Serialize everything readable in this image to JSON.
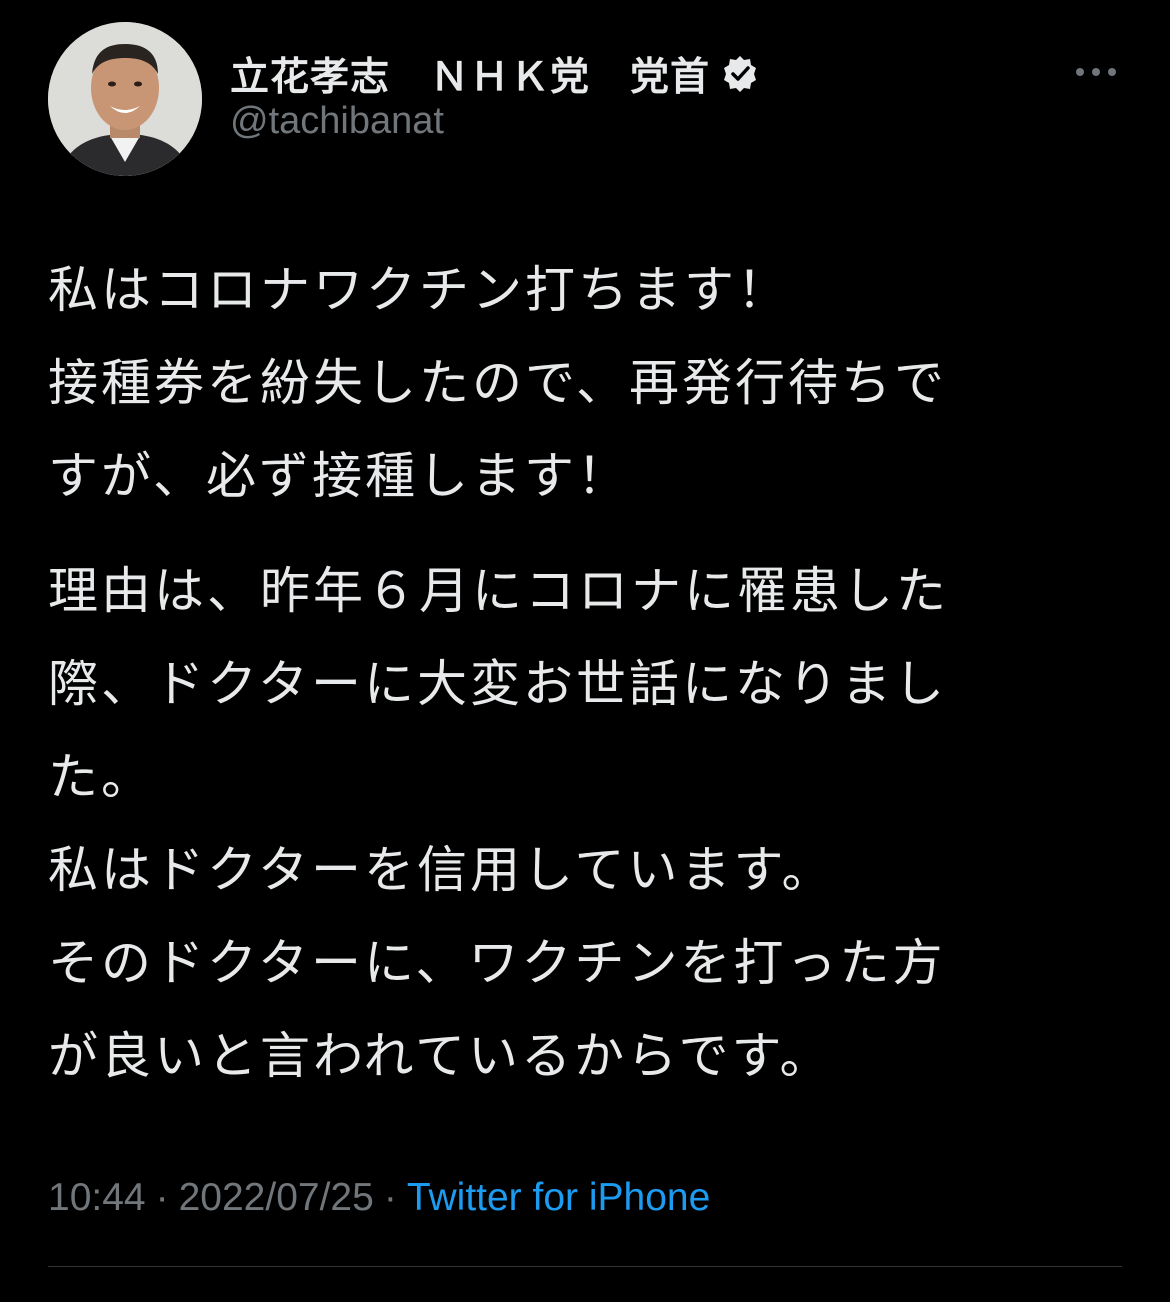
{
  "author": {
    "display_name": "立花孝志　ＮＨＫ党　党首",
    "handle": "@tachibanat",
    "verified": true
  },
  "icons": {
    "avatar": "avatar",
    "verified": "verified-badge-icon",
    "more": "more-options-icon"
  },
  "tweet": {
    "paragraphs": [
      "私はコロナワクチン打ちます！\n接種券を紛失したので、再発行待ちで\nすが、必ず接種します！",
      "理由は、昨年６月にコロナに罹患した\n際、ドクターに大変お世話になりまし\nた。\n私はドクターを信用しています。\nそのドクターに、ワクチンを打った方\nが良いと言われているからです。"
    ]
  },
  "meta": {
    "time": "10:44",
    "separator": "·",
    "date": "2022/07/25",
    "source": "Twitter for iPhone"
  },
  "colors": {
    "background": "#000000",
    "text": "#e7e9ea",
    "secondary": "#71767b",
    "link": "#1d9bf0",
    "divider": "#2f3336"
  }
}
